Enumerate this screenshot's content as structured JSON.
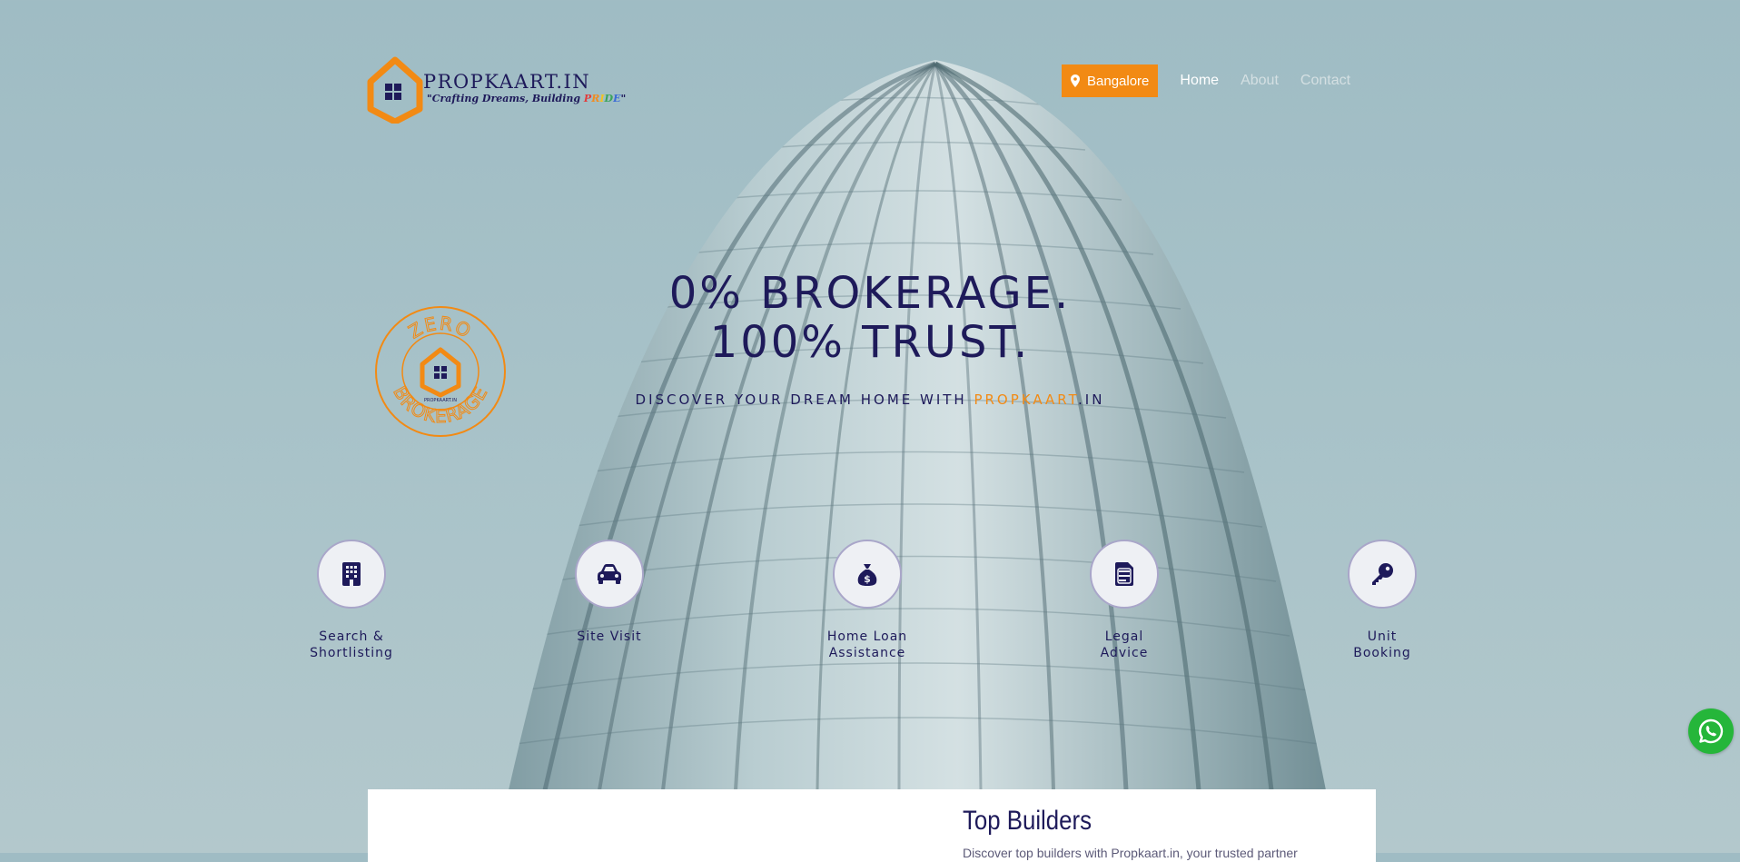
{
  "brand": {
    "name": "PROPKAART.IN",
    "tagline_prefix": "\"Crafting Dreams, Building ",
    "tagline_letters": [
      "P",
      "R",
      "I",
      "D",
      "E"
    ],
    "tagline_suffix": "\"",
    "accent_color": "#f28a14",
    "primary_color": "#1e1a5a"
  },
  "nav": {
    "city": "Bangalore",
    "city_icon": "map-pin-icon",
    "links": [
      "Home",
      "About",
      "Contact"
    ]
  },
  "stamp": {
    "top_text": "ZERO",
    "bottom_text": "BROKERAGE",
    "inner_text": "PROPKAART.IN"
  },
  "hero": {
    "title_line1": "0% BROKERAGE.",
    "title_line2": "100% TRUST.",
    "subtitle_prefix": "DISCOVER YOUR DREAM HOME WITH ",
    "subtitle_brand_orange": "PROPKAART",
    "subtitle_brand_suffix": ".IN"
  },
  "services": [
    {
      "label_line1": "Search &",
      "label_line2": "Shortlisting",
      "icon": "building-icon"
    },
    {
      "label_line1": "Site Visit",
      "label_line2": "",
      "icon": "car-icon"
    },
    {
      "label_line1": "Home Loan",
      "label_line2": "Assistance",
      "icon": "money-bag-icon"
    },
    {
      "label_line1": "Legal",
      "label_line2": "Advice",
      "icon": "document-icon"
    },
    {
      "label_line1": "Unit",
      "label_line2": "Booking",
      "icon": "key-icon"
    }
  ],
  "whatsapp": {
    "icon": "whatsapp-icon",
    "color": "#25b63a"
  },
  "builders": {
    "title": "Top Builders",
    "description": "Discover top builders with Propkaart.in, your trusted partner"
  }
}
